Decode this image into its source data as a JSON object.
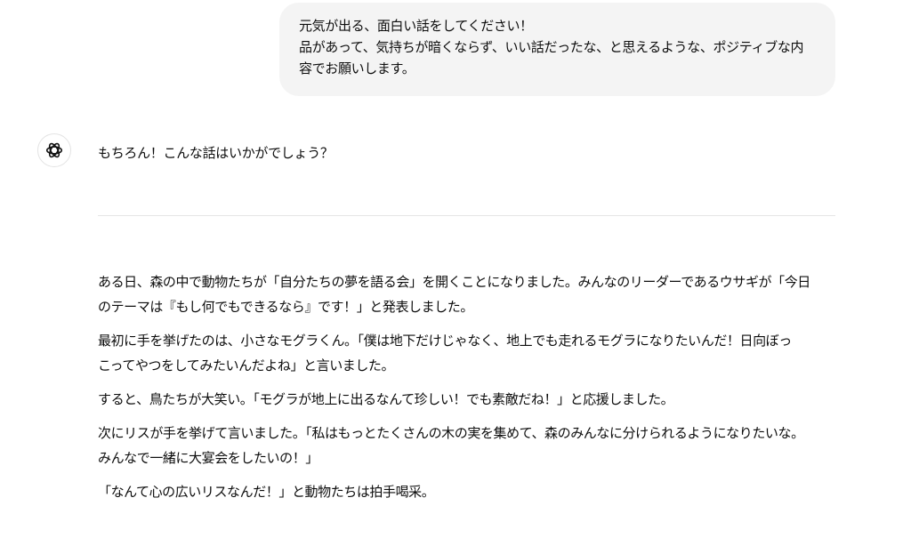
{
  "user_message": {
    "lines": [
      "元気が出る、面白い話をしてください！",
      "品があって、気持ちが暗くならず、いい話だったな、と思えるような、ポジティブな内",
      "容でお願いします。"
    ]
  },
  "assistant": {
    "avatar_icon": "chatgpt-logo-icon",
    "intro": "もちろん！こんな話はいかがでしょう？",
    "paragraphs": [
      {
        "lines": [
          "ある日、森の中で動物たちが「自分たちの夢を語る会」を開くことになりました。みんなのリーダーであるウサギが「今日",
          "のテーマは『もし何でもできるなら』です！」と発表しました。"
        ]
      },
      {
        "lines": [
          "最初に手を挙げたのは、小さなモグラくん。「僕は地下だけじゃなく、地上でも走れるモグラになりたいんだ！日向ぼっ",
          "こってやつをしてみたいんだよね」と言いました。"
        ]
      },
      {
        "lines": [
          "すると、鳥たちが大笑い。「モグラが地上に出るなんて珍しい！でも素敵だね！」と応援しました。"
        ]
      },
      {
        "lines": [
          "次にリスが手を挙げて言いました。「私はもっとたくさんの木の実を集めて、森のみんなに分けられるようになりたいな。",
          "みんなで一緒に大宴会をしたいの！」"
        ]
      },
      {
        "lines": [
          "「なんて心の広いリスなんだ！」と動物たちは拍手喝采。"
        ]
      }
    ]
  }
}
